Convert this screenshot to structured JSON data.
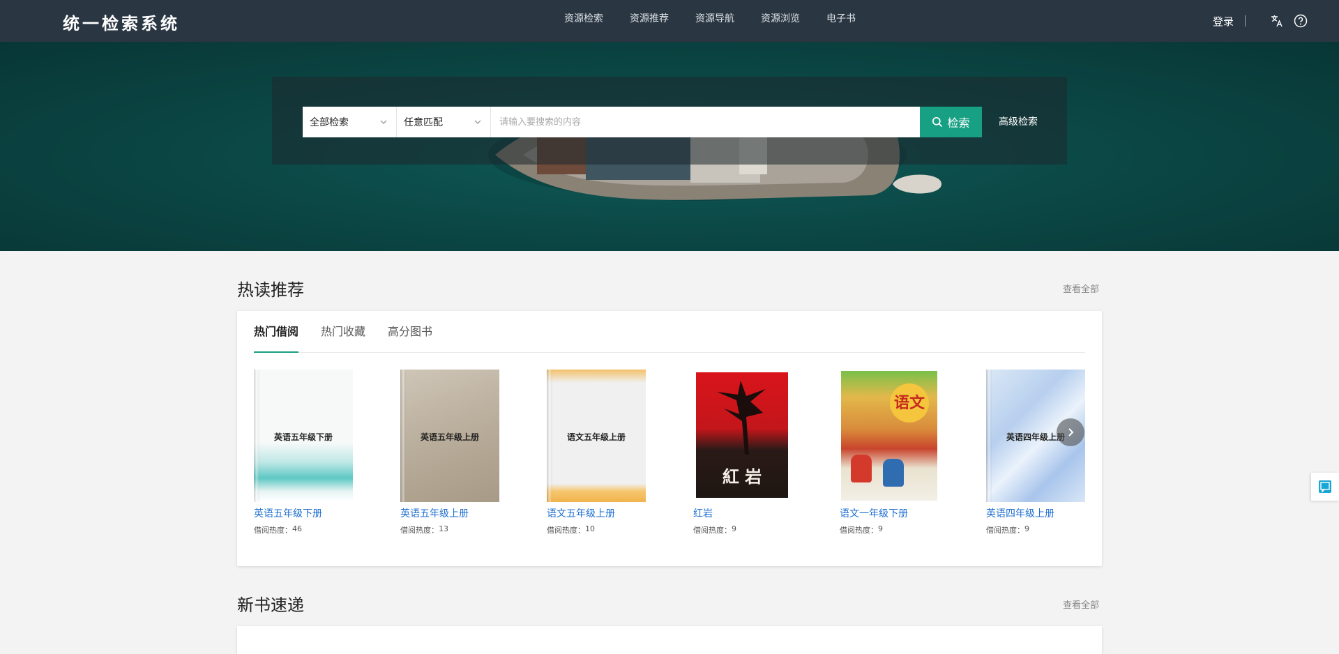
{
  "header": {
    "logo": "统一检索系统",
    "nav": [
      "资源检索",
      "资源推荐",
      "资源导航",
      "资源浏览",
      "电子书"
    ],
    "login": "登录"
  },
  "search": {
    "scope": "全部检索",
    "match": "任意匹配",
    "placeholder": "请输入要搜索的内容",
    "button": "检索",
    "advanced": "高级检索"
  },
  "hot": {
    "title": "热读推荐",
    "view_all": "查看全部",
    "tabs": [
      "热门借阅",
      "热门收藏",
      "高分图书"
    ],
    "active_tab": 0,
    "heat_label": "借阅热度：",
    "books": [
      {
        "title": "英语五年级下册",
        "cover_text": "英语五年级下册",
        "heat": "46"
      },
      {
        "title": "英语五年级上册",
        "cover_text": "英语五年级上册",
        "heat": "13"
      },
      {
        "title": "语文五年级上册",
        "cover_text": "语文五年级上册",
        "heat": "10"
      },
      {
        "title": "红岩",
        "cover_text": "紅 岩",
        "heat": "9"
      },
      {
        "title": "语文一年级下册",
        "cover_text": "语文",
        "heat": "9"
      },
      {
        "title": "英语四年级上册",
        "cover_text": "英语四年级上册",
        "heat": "9"
      }
    ]
  },
  "new_books": {
    "title": "新书速递",
    "view_all": "查看全部"
  },
  "icons": {
    "translate": "translate-icon",
    "help": "help-icon",
    "search": "search-icon",
    "next": "chevron-right-icon",
    "float": "feedback-icon"
  },
  "colors": {
    "topbar": "#2a3642",
    "accent": "#18a085",
    "link": "#1f6fd1"
  }
}
